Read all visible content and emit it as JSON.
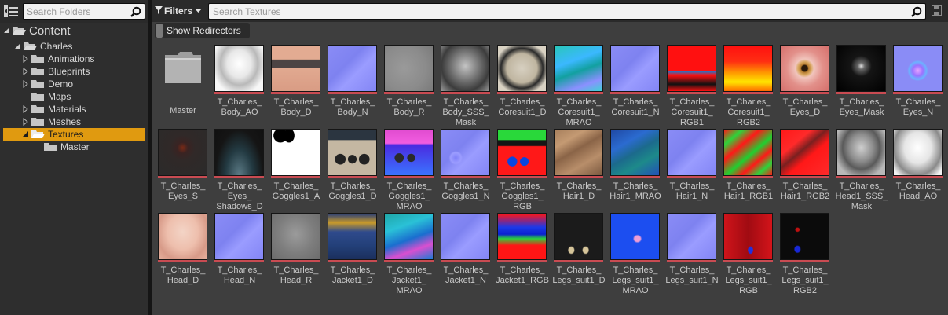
{
  "folder_panel": {
    "search_placeholder": "Search Folders",
    "tree": [
      {
        "label": "Content",
        "level": 0,
        "expanded": true,
        "selected": false
      },
      {
        "label": "Charles",
        "level": 1,
        "expanded": true,
        "selected": false
      },
      {
        "label": "Animations",
        "level": 2,
        "expanded": false,
        "selected": false
      },
      {
        "label": "Blueprints",
        "level": 2,
        "expanded": false,
        "selected": false
      },
      {
        "label": "Demo",
        "level": 2,
        "expanded": false,
        "selected": false
      },
      {
        "label": "Maps",
        "level": 2,
        "expanded": null,
        "selected": false
      },
      {
        "label": "Materials",
        "level": 2,
        "expanded": false,
        "selected": false
      },
      {
        "label": "Meshes",
        "level": 2,
        "expanded": false,
        "selected": false
      },
      {
        "label": "Textures",
        "level": 2,
        "expanded": true,
        "selected": true
      },
      {
        "label": "Master",
        "level": 3,
        "expanded": null,
        "selected": false
      }
    ]
  },
  "asset_panel": {
    "filters_label": "Filters",
    "search_placeholder": "Search Textures",
    "show_redirectors_label": "Show Redirectors",
    "assets": [
      {
        "name": "Master",
        "type": "folder"
      },
      {
        "name": "T_Charles_\nBody_AO",
        "type": "ao"
      },
      {
        "name": "T_Charles_\nBody_D",
        "type": "skin"
      },
      {
        "name": "T_Charles_\nBody_N",
        "type": "normal"
      },
      {
        "name": "T_Charles_\nBody_R",
        "type": "gray"
      },
      {
        "name": "T_Charles_\nBody_SSS_\nMask",
        "type": "graydark"
      },
      {
        "name": "T_Charles_\nCoresuit1_D",
        "type": "beige"
      },
      {
        "name": "T_Charles_\nCoresuit1_\nMRAO",
        "type": "mrao"
      },
      {
        "name": "T_Charles_\nCoresuit1_N",
        "type": "normal"
      },
      {
        "name": "T_Charles_\nCoresuit1_\nRGB1",
        "type": "rgb1"
      },
      {
        "name": "T_Charles_\nCoresuit1_\nRGB2",
        "type": "rgb2"
      },
      {
        "name": "T_Charles_\nEyes_D",
        "type": "eye"
      },
      {
        "name": "T_Charles_\nEyes_Mask",
        "type": "eyemask"
      },
      {
        "name": "T_Charles_\nEyes_N",
        "type": "eyenormal"
      },
      {
        "name": "T_Charles_\nEyes_S",
        "type": "eyes_s"
      },
      {
        "name": "T_Charles_\nEyes_\nShadows_D",
        "type": "shadow"
      },
      {
        "name": "T_Charles_\nGoggles1_A",
        "type": "white"
      },
      {
        "name": "T_Charles_\nGoggles1_D",
        "type": "goggled"
      },
      {
        "name": "T_Charles_\nGoggles1_\nMRAO",
        "type": "gogglemrao"
      },
      {
        "name": "T_Charles_\nGoggles1_N",
        "type": "gogglenormal"
      },
      {
        "name": "T_Charles_\nGoggles1_\nRGB",
        "type": "gogglergb"
      },
      {
        "name": "T_Charles_\nHair1_D",
        "type": "hair"
      },
      {
        "name": "T_Charles_\nHair1_MRAO",
        "type": "hairmrao"
      },
      {
        "name": "T_Charles_\nHair1_N",
        "type": "normal"
      },
      {
        "name": "T_Charles_\nHair1_RGB1",
        "type": "hairrgb1"
      },
      {
        "name": "T_Charles_\nHair1_RGB2",
        "type": "hairrgb2"
      },
      {
        "name": "T_Charles_\nHead1_SSS_\nMask",
        "type": "headmask"
      },
      {
        "name": "T_Charles_\nHead_AO",
        "type": "headao"
      },
      {
        "name": "T_Charles_\nHead_D",
        "type": "headd"
      },
      {
        "name": "T_Charles_\nHead_N",
        "type": "normal"
      },
      {
        "name": "T_Charles_\nHead_R",
        "type": "headr"
      },
      {
        "name": "T_Charles_\nJacket1_D",
        "type": "jacketd"
      },
      {
        "name": "T_Charles_\nJacket1_\nMRAO",
        "type": "jacketmrao"
      },
      {
        "name": "T_Charles_\nJacket1_N",
        "type": "normal"
      },
      {
        "name": "T_Charles_\nJacket1_RGB",
        "type": "jacketrgb"
      },
      {
        "name": "T_Charles_\nLegs_suit1_D",
        "type": "legsd"
      },
      {
        "name": "T_Charles_\nLegs_suit1_\nMRAO",
        "type": "legsmrao"
      },
      {
        "name": "T_Charles_\nLegs_suit1_N",
        "type": "normal"
      },
      {
        "name": "T_Charles_\nLegs_suit1_\nRGB",
        "type": "legsrgb"
      },
      {
        "name": "T_Charles_\nLegs_suit1_\nRGB2",
        "type": "legsrgb2"
      }
    ]
  },
  "colors": {
    "selection": "#e09a10",
    "texture_bar": "#c94b52",
    "panel": "#3e3e3e"
  }
}
